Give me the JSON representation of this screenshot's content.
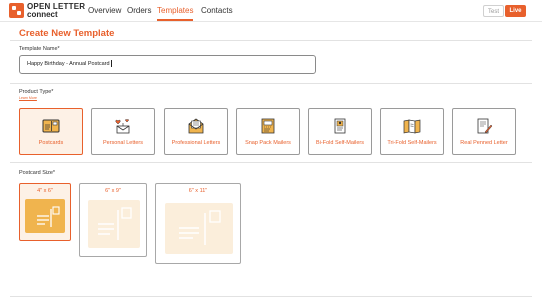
{
  "header": {
    "logo_line1": "OPEN LETTER",
    "logo_line2": "connect",
    "nav": [
      {
        "label": "Overview"
      },
      {
        "label": "Orders"
      },
      {
        "label": "Templates",
        "active": true
      },
      {
        "label": "Contacts"
      }
    ],
    "mode_toggle": {
      "test_label": "Test",
      "live_label": "Live",
      "selected": "Live"
    }
  },
  "page": {
    "title": "Create New Template"
  },
  "form": {
    "template_name_label": "Template Name*",
    "template_name_value": "Happy Birthday - Annual Postcard",
    "product_type_label": "Product Type*",
    "product_type_link": "Learn More",
    "product_types": [
      {
        "label": "Postcards",
        "icon": "postcard-icon",
        "selected": true
      },
      {
        "label": "Personal Letters",
        "icon": "personal-letter-icon",
        "selected": false
      },
      {
        "label": "Professional Letters",
        "icon": "envelope-icon",
        "selected": false
      },
      {
        "label": "Snap Pack Mailers",
        "icon": "snap-pack-icon",
        "selected": false
      },
      {
        "label": "Bi-Fold Self-Mailers",
        "icon": "bifold-icon",
        "selected": false
      },
      {
        "label": "Tri-Fold Self-Mailers",
        "icon": "trifold-icon",
        "selected": false
      },
      {
        "label": "Real Penned Letter",
        "icon": "pen-letter-icon",
        "selected": false
      }
    ],
    "postcard_size_label": "Postcard Size*",
    "postcard_sizes": [
      {
        "label": "4\" x 6\"",
        "selected": true
      },
      {
        "label": "6\" x 9\"",
        "selected": false
      },
      {
        "label": "6\" x 11\"",
        "selected": false
      }
    ]
  },
  "colors": {
    "accent": "#e8602c",
    "selected_bg": "#fdf1e6",
    "postcard_fill_selected": "#f0b44e",
    "postcard_fill_muted": "#fbeedb"
  }
}
